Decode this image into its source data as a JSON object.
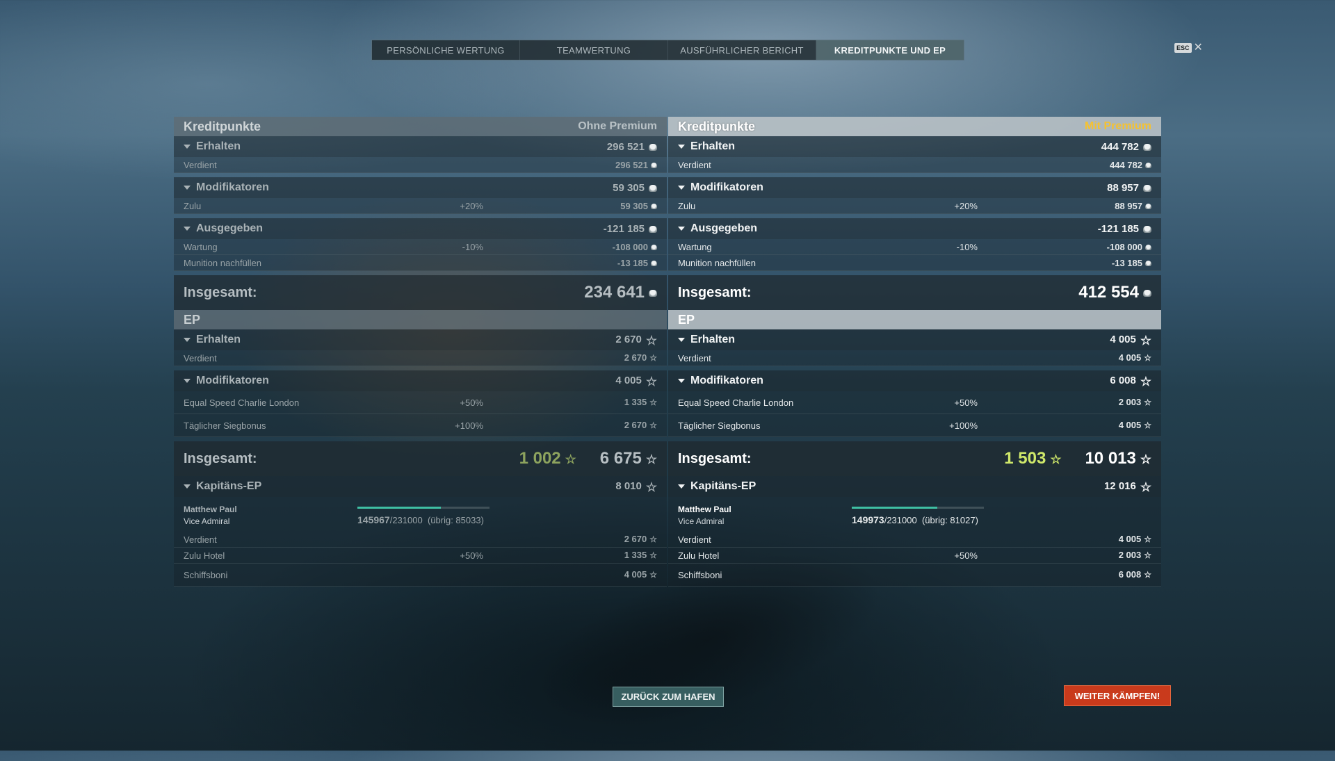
{
  "tabs": [
    {
      "label": "PERSÖNLICHE WERTUNG"
    },
    {
      "label": "TEAMWERTUNG"
    },
    {
      "label": "AUSFÜHRLICHER BERICHT"
    },
    {
      "label": "KREDITPUNKTE UND EP"
    }
  ],
  "esc_label": "ESC",
  "colors": {
    "premium": "#f5c230",
    "progress": "#3fbfa3",
    "battle_button": "#c93a1c"
  },
  "left": {
    "credits_title": "Kreditpunkte",
    "account_type": "Ohne Premium",
    "earned_label": "Erhalten",
    "earned_total": "296 521",
    "earned_row_label": "Verdient",
    "earned_row_val": "296 521",
    "mods_label": "Modifikatoren",
    "mods_total": "59 305",
    "mods_row_label": "Zulu",
    "mods_row_pct": "+20%",
    "mods_row_val": "59 305",
    "spent_label": "Ausgegeben",
    "spent_total": "-121 185",
    "spent_row1_label": "Wartung",
    "spent_row1_pct": "-10%",
    "spent_row1_val": "-108 000",
    "spent_row2_label": "Munition nachfüllen",
    "spent_row2_val": "-13 185",
    "total_label": "Insgesamt:",
    "total_val": "234 641",
    "ep_title": "EP",
    "ep_earned_label": "Erhalten",
    "ep_earned_total": "2 670",
    "ep_earned_row_label": "Verdient",
    "ep_earned_row_val": "2 670",
    "ep_mods_label": "Modifikatoren",
    "ep_mods_total": "4 005",
    "ep_mod1_label": "Equal Speed Charlie London",
    "ep_mod1_pct": "+50%",
    "ep_mod1_val": "1 335",
    "ep_mod2_label": "Täglicher Siegbonus",
    "ep_mod2_pct": "+100%",
    "ep_mod2_val": "2 670",
    "ep_total_label": "Insgesamt:",
    "ep_total_bonus": "1 002",
    "ep_total_val": "6 675",
    "cap_label": "Kapitäns-EP",
    "cap_total": "8 010",
    "cap_name": "Matthew Paul",
    "cap_rank": "Vice Admiral",
    "cap_current": "145967",
    "cap_max": "/231000",
    "cap_remaining": "(übrig: 85033)",
    "cap_progress_fraction": 0.632,
    "cap_row1_label": "Verdient",
    "cap_row1_val": "2 670",
    "cap_row2_label": "Zulu Hotel",
    "cap_row2_pct": "+50%",
    "cap_row2_val": "1 335",
    "cap_row3_label": "Schiffsboni",
    "cap_row3_val": "4 005"
  },
  "right": {
    "credits_title": "Kreditpunkte",
    "account_type": "Mit Premium",
    "earned_label": "Erhalten",
    "earned_total": "444 782",
    "earned_row_label": "Verdient",
    "earned_row_val": "444 782",
    "mods_label": "Modifikatoren",
    "mods_total": "88 957",
    "mods_row_label": "Zulu",
    "mods_row_pct": "+20%",
    "mods_row_val": "88 957",
    "spent_label": "Ausgegeben",
    "spent_total": "-121 185",
    "spent_row1_label": "Wartung",
    "spent_row1_pct": "-10%",
    "spent_row1_val": "-108 000",
    "spent_row2_label": "Munition nachfüllen",
    "spent_row2_val": "-13 185",
    "total_label": "Insgesamt:",
    "total_val": "412 554",
    "ep_title": "EP",
    "ep_earned_label": "Erhalten",
    "ep_earned_total": "4 005",
    "ep_earned_row_label": "Verdient",
    "ep_earned_row_val": "4 005",
    "ep_mods_label": "Modifikatoren",
    "ep_mods_total": "6 008",
    "ep_mod1_label": "Equal Speed Charlie London",
    "ep_mod1_pct": "+50%",
    "ep_mod1_val": "2 003",
    "ep_mod2_label": "Täglicher Siegbonus",
    "ep_mod2_pct": "+100%",
    "ep_mod2_val": "4 005",
    "ep_total_label": "Insgesamt:",
    "ep_total_bonus": "1 503",
    "ep_total_val": "10 013",
    "cap_label": "Kapitäns-EP",
    "cap_total": "12 016",
    "cap_name": "Matthew Paul",
    "cap_rank": "Vice Admiral",
    "cap_current": "149973",
    "cap_max": "/231000",
    "cap_remaining": "(übrig: 81027)",
    "cap_progress_fraction": 0.649,
    "cap_row1_label": "Verdient",
    "cap_row1_val": "4 005",
    "cap_row2_label": "Zulu Hotel",
    "cap_row2_pct": "+50%",
    "cap_row2_val": "2 003",
    "cap_row3_label": "Schiffsboni",
    "cap_row3_val": "6 008"
  },
  "buttons": {
    "back": "ZURÜCK ZUM HAFEN",
    "battle": "WEITER KÄMPFEN!"
  },
  "icons": {
    "credits": "credits-coin-icon",
    "xp": "xp-star-icon",
    "collapse": "triangle-down-icon"
  }
}
